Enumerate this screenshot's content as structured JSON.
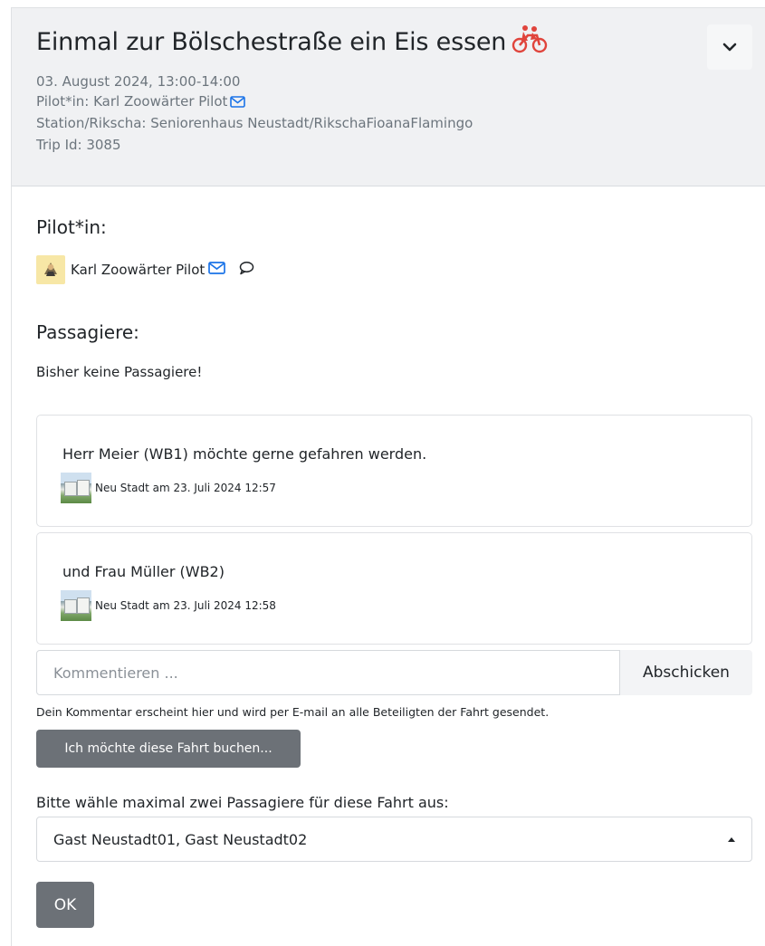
{
  "trip": {
    "title": "Einmal zur Bölschestraße ein Eis essen",
    "date": "03. August 2024, 13:00-14:00",
    "pilot_line": "Pilot*in: Karl Zoowärter Pilot",
    "station_line": "Station/Rikscha: Seniorenhaus Neustadt/RikschaFioanaFlamingo",
    "trip_id_line": "Trip Id: 3085",
    "title_icon": "rickshaw-icon",
    "collapse_icon": "chevron-down-icon"
  },
  "pilot_section": {
    "heading": "Pilot*in:",
    "name": "Karl Zoowärter Pilot"
  },
  "passengers_section": {
    "heading": "Passagiere:",
    "empty_text": "Bisher keine Passagiere!"
  },
  "comments": [
    {
      "text": "Herr Meier (WB1) möchte gerne gefahren werden.",
      "meta": "Neu Stadt am 23. Juli 2024 12:57"
    },
    {
      "text": "und Frau Müller (WB2)",
      "meta": "Neu Stadt am 23. Juli 2024 12:58"
    }
  ],
  "comment_form": {
    "placeholder": "Kommentieren ...",
    "submit_label": "Abschicken",
    "hint": "Dein Kommentar erscheint hier und wird per E-mail an alle Beteiligten der Fahrt gesendet."
  },
  "booking": {
    "book_label": "Ich möchte diese Fahrt buchen...",
    "select_label": "Bitte wähle maximal zwei Passagiere für diese Fahrt aus:",
    "selected_value": "Gast Neustadt01, Gast Neustadt02",
    "ok_label": "OK"
  },
  "colors": {
    "header_bg": "#f0f1f3",
    "accent_blue": "#1a73e8",
    "rickshaw_red": "#e0443c",
    "button_gray": "#6c7177"
  }
}
